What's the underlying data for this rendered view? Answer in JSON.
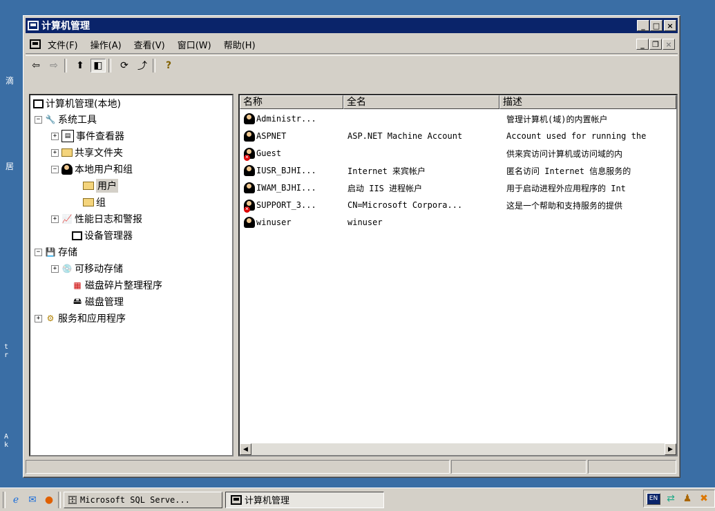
{
  "desktop_fragments": [
    "滴",
    "居",
    "t",
    "r",
    "A",
    "k"
  ],
  "window": {
    "title": "计算机管理",
    "min": "_",
    "max": "□",
    "close": "×"
  },
  "menu": [
    "文件(F)",
    "操作(A)",
    "查看(V)",
    "窗口(W)",
    "帮助(H)"
  ],
  "mdi": {
    "min": "_",
    "restore": "❐",
    "close": "×"
  },
  "toolbar": {
    "back": "⇦",
    "forward": "⇨",
    "up": "⬆",
    "showhide": "◧",
    "refresh": "⟳",
    "export": "⤴",
    "help": "?"
  },
  "tree": [
    {
      "label": "计算机管理(本地)",
      "level": 0,
      "exp": ""
    },
    {
      "label": "系统工具",
      "level": 1,
      "exp": "−"
    },
    {
      "label": "事件查看器",
      "level": 2,
      "exp": "+"
    },
    {
      "label": "共享文件夹",
      "level": 2,
      "exp": "+"
    },
    {
      "label": "本地用户和组",
      "level": 2,
      "exp": "−"
    },
    {
      "label": "用户",
      "level": 3,
      "exp": ""
    },
    {
      "label": "组",
      "level": 3,
      "exp": ""
    },
    {
      "label": "性能日志和警报",
      "level": 2,
      "exp": "+"
    },
    {
      "label": "设备管理器",
      "level": 2,
      "exp": ""
    },
    {
      "label": "存储",
      "level": 1,
      "exp": "−"
    },
    {
      "label": "可移动存储",
      "level": 2,
      "exp": "+"
    },
    {
      "label": "磁盘碎片整理程序",
      "level": 2,
      "exp": ""
    },
    {
      "label": "磁盘管理",
      "level": 2,
      "exp": ""
    },
    {
      "label": "服务和应用程序",
      "level": 1,
      "exp": "+"
    }
  ],
  "columns": [
    "名称",
    "全名",
    "描述"
  ],
  "users": [
    {
      "name": "Administr...",
      "full": "",
      "desc": "管理计算机(域)的内置帐户",
      "disabled": false
    },
    {
      "name": "ASPNET",
      "full": "ASP.NET Machine Account",
      "desc": "Account used for running the",
      "disabled": false
    },
    {
      "name": "Guest",
      "full": "",
      "desc": "供来宾访问计算机或访问域的内",
      "disabled": true
    },
    {
      "name": "IUSR_BJHI...",
      "full": "Internet 来宾帐户",
      "desc": "匿名访问 Internet 信息服务的",
      "disabled": false
    },
    {
      "name": "IWAM_BJHI...",
      "full": "启动 IIS 进程帐户",
      "desc": "用于启动进程外应用程序的 Int",
      "disabled": false
    },
    {
      "name": "SUPPORT_3...",
      "full": "CN=Microsoft Corpora...",
      "desc": "这是一个帮助和支持服务的提供",
      "disabled": true
    },
    {
      "name": "winuser",
      "full": "winuser",
      "desc": "",
      "disabled": false
    }
  ],
  "taskbar": {
    "tasks": [
      "Microsoft SQL Serve...",
      "计算机管理"
    ],
    "tray_lang": "EN"
  }
}
